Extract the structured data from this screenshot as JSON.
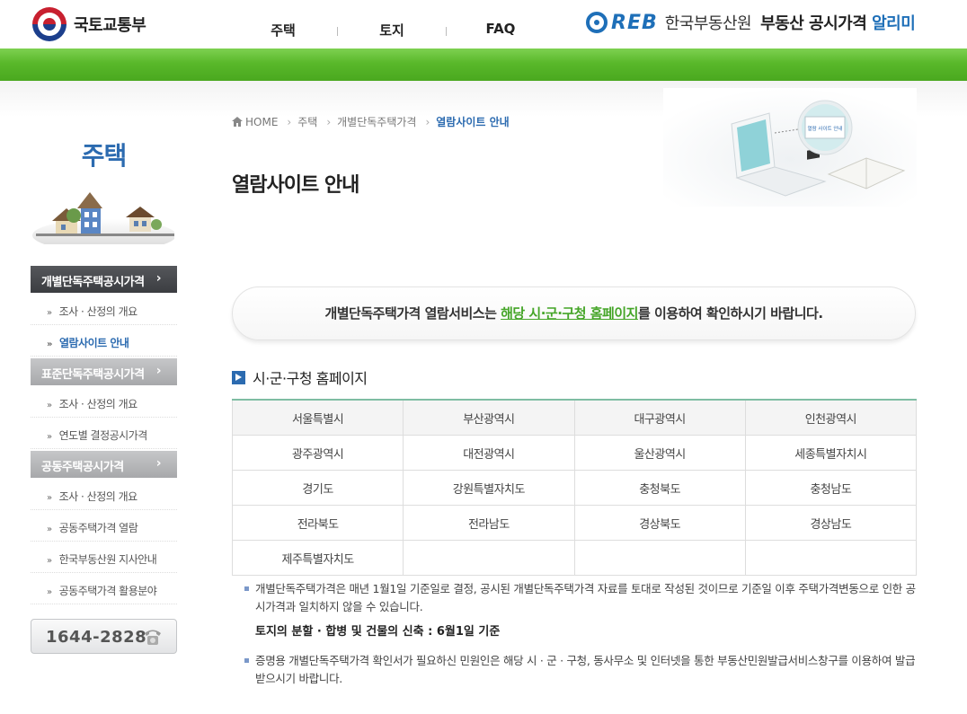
{
  "header": {
    "logo_text": "국토교통부",
    "nav": [
      "주택",
      "토지",
      "FAQ"
    ],
    "reb_letters": "REB",
    "reb_name": "한국부동산원",
    "service_main": "부동산 공시가격",
    "service_accent": "알리미"
  },
  "sidebar": {
    "title": "주택",
    "groups": [
      {
        "label": "개별단독주택공시가격",
        "items": [
          "조사 · 산정의 개요",
          "열람사이트 안내"
        ]
      },
      {
        "label": "표준단독주택공시가격",
        "items": [
          "조사 · 산정의 개요",
          "연도별 결정공시가격"
        ]
      },
      {
        "label": "공동주택공시가격",
        "items": [
          "조사 · 산정의 개요",
          "공동주택가격 열람",
          "한국부동산원 지사안내",
          "공동주택가격 활용분야"
        ]
      }
    ],
    "phone": "1644-2828"
  },
  "breadcrumb": [
    "HOME",
    "주택",
    "개별단독주택가격",
    "열람사이트 안내"
  ],
  "visual_screen_text": "열람 사이트 안내",
  "page_title": "열람사이트 안내",
  "notice": {
    "before": "개별단독주택가격 열람서비스는 ",
    "highlight": "해당 시·군·구청 홈페이지",
    "after": "를 이용하여 확인하시기 바랍니다."
  },
  "section_title": "시·군·구청 홈페이지",
  "regions": [
    [
      "서울특별시",
      "부산광역시",
      "대구광역시",
      "인천광역시"
    ],
    [
      "광주광역시",
      "대전광역시",
      "울산광역시",
      "세종특별자치시"
    ],
    [
      "경기도",
      "강원특별자치도",
      "충청북도",
      "충청남도"
    ],
    [
      "전라북도",
      "전라남도",
      "경상북도",
      "경상남도"
    ],
    [
      "제주특별자치도",
      "",
      "",
      ""
    ]
  ],
  "descriptions": {
    "item1": "개별단독주택가격은 매년 1월1일 기준일로 결정, 공시된 개별단독주택가격 자료를 토대로 작성된 것이므로 기준일 이후 주택가격변동으로 인한 공시가격과 일치하지 않을 수 있습니다.",
    "item1_bold": "토지의 분할 · 합병 및 건물의 신축 : 6월1일 기준",
    "item2": "증명용 개별단독주택가격 확인서가 필요하신 민원인은 해당 시 · 군 · 구청, 동사무소 및 인터넷을 통한 부동산민원발급서비스창구를 이용하여 발급 받으시기 바랍니다."
  },
  "colors": {
    "green_bar": "#5cb82c",
    "accent_blue": "#2c6bb0",
    "highlight_green": "#45a528"
  }
}
